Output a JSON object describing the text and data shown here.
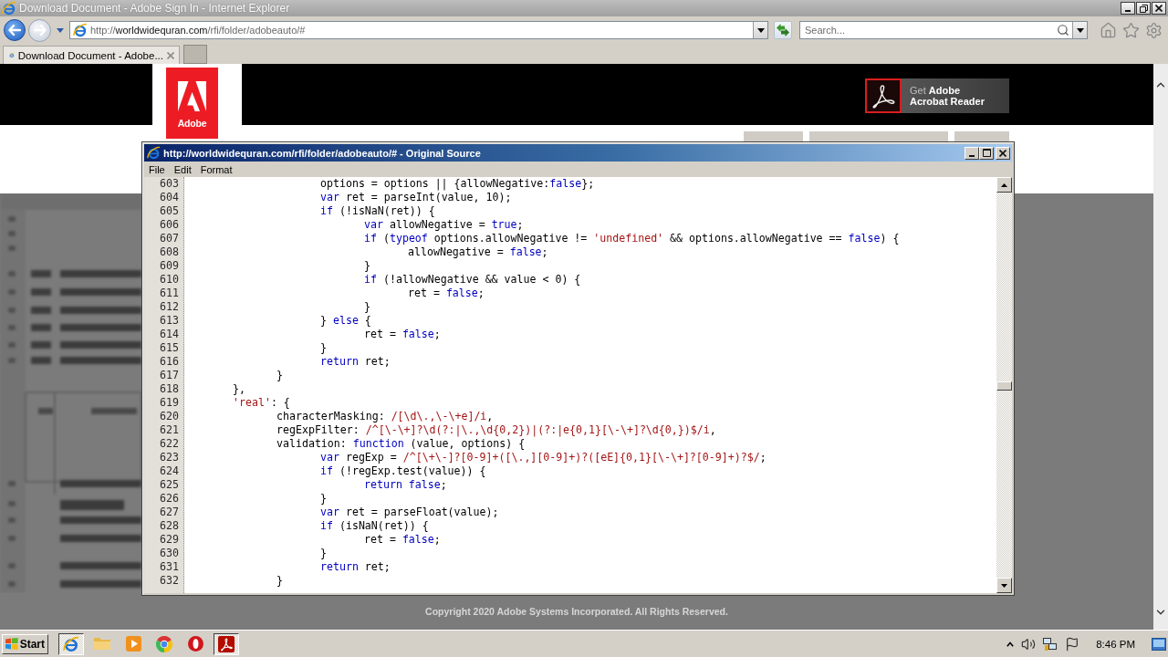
{
  "browser": {
    "title": "Download Document - Adobe Sign In - Internet Explorer",
    "address": {
      "scheme": "http://",
      "host": "worldwidequran.com",
      "path": "/rfi/folder/adobeauto/#"
    },
    "search": {
      "placeholder": "Search..."
    },
    "tabs": [
      {
        "label": "Download Document - Adobe...",
        "selected": true
      }
    ]
  },
  "page": {
    "logo_text": "Adobe",
    "reader_button": {
      "line_1": "Get **Adobe**",
      "line_2": "Acrobat Reader"
    },
    "copyright": "Copyright 2020 Adobe Systems Incorporated. All Rights Reserved."
  },
  "source_window": {
    "title": "http://worldwidequran.com/rfi/folder/adobeauto/# - Original Source",
    "menu": [
      "File",
      "Edit",
      "Format"
    ],
    "lines": [
      {
        "number": "603",
        "tokens": [
          {
            "kind": "plain",
            "text": "\t\t\toptions = options || {allowNegative:"
          },
          {
            "kind": "keyword",
            "text": "false"
          },
          {
            "kind": "plain",
            "text": "};"
          }
        ]
      },
      {
        "number": "604",
        "tokens": [
          {
            "kind": "keyword",
            "text": "\t\t\tvar"
          },
          {
            "kind": "plain",
            "text": " ret = parseInt(value, 10);"
          }
        ]
      },
      {
        "number": "605",
        "tokens": [
          {
            "kind": "keyword",
            "text": "\t\t\tif"
          },
          {
            "kind": "plain",
            "text": " (!isNaN(ret)) {"
          }
        ]
      },
      {
        "number": "606",
        "tokens": [
          {
            "kind": "keyword",
            "text": "\t\t\t\tvar"
          },
          {
            "kind": "plain",
            "text": " allowNegative = "
          },
          {
            "kind": "keyword",
            "text": "true"
          },
          {
            "kind": "plain",
            "text": ";"
          }
        ]
      },
      {
        "number": "607",
        "tokens": [
          {
            "kind": "keyword",
            "text": "\t\t\t\tif"
          },
          {
            "kind": "plain",
            "text": " ("
          },
          {
            "kind": "keyword",
            "text": "typeof"
          },
          {
            "kind": "plain",
            "text": " options.allowNegative != "
          },
          {
            "kind": "string",
            "text": "'undefined'"
          },
          {
            "kind": "plain",
            "text": " && options.allowNegative == "
          },
          {
            "kind": "keyword",
            "text": "false"
          },
          {
            "kind": "plain",
            "text": ") {"
          }
        ]
      },
      {
        "number": "608",
        "tokens": [
          {
            "kind": "plain",
            "text": "\t\t\t\t\tallowNegative = "
          },
          {
            "kind": "keyword",
            "text": "false"
          },
          {
            "kind": "plain",
            "text": ";"
          }
        ]
      },
      {
        "number": "609",
        "tokens": [
          {
            "kind": "plain",
            "text": "\t\t\t\t}"
          }
        ]
      },
      {
        "number": "610",
        "tokens": [
          {
            "kind": "keyword",
            "text": "\t\t\t\tif"
          },
          {
            "kind": "plain",
            "text": " (!allowNegative && value < 0) {"
          }
        ]
      },
      {
        "number": "611",
        "tokens": [
          {
            "kind": "plain",
            "text": "\t\t\t\t\tret = "
          },
          {
            "kind": "keyword",
            "text": "false"
          },
          {
            "kind": "plain",
            "text": ";"
          }
        ]
      },
      {
        "number": "612",
        "tokens": [
          {
            "kind": "plain",
            "text": "\t\t\t\t}"
          }
        ]
      },
      {
        "number": "613",
        "tokens": [
          {
            "kind": "plain",
            "text": "\t\t\t} "
          },
          {
            "kind": "keyword",
            "text": "else"
          },
          {
            "kind": "plain",
            "text": " {"
          }
        ]
      },
      {
        "number": "614",
        "tokens": [
          {
            "kind": "plain",
            "text": "\t\t\t\tret = "
          },
          {
            "kind": "keyword",
            "text": "false"
          },
          {
            "kind": "plain",
            "text": ";"
          }
        ]
      },
      {
        "number": "615",
        "tokens": [
          {
            "kind": "plain",
            "text": "\t\t\t}"
          }
        ]
      },
      {
        "number": "616",
        "tokens": [
          {
            "kind": "keyword",
            "text": "\t\t\treturn"
          },
          {
            "kind": "plain",
            "text": " ret;"
          }
        ]
      },
      {
        "number": "617",
        "tokens": [
          {
            "kind": "plain",
            "text": "\t\t}"
          }
        ]
      },
      {
        "number": "618",
        "tokens": [
          {
            "kind": "plain",
            "text": "\t},"
          }
        ]
      },
      {
        "number": "619",
        "tokens": [
          {
            "kind": "string",
            "text": "\t'real'"
          },
          {
            "kind": "plain",
            "text": ": {"
          }
        ]
      },
      {
        "number": "620",
        "tokens": [
          {
            "kind": "plain",
            "text": "\t\tcharacterMasking: "
          },
          {
            "kind": "string",
            "text": "/[\\d\\.,\\-\\+e]/i"
          },
          {
            "kind": "plain",
            "text": ","
          }
        ]
      },
      {
        "number": "621",
        "tokens": [
          {
            "kind": "plain",
            "text": "\t\tregExpFilter: "
          },
          {
            "kind": "string",
            "text": "/^[\\-\\+]?\\d(?:|\\.,\\d{0,2})|(?:|e{0,1}[\\-\\+]?\\d{0,})$/i"
          },
          {
            "kind": "plain",
            "text": ","
          }
        ]
      },
      {
        "number": "622",
        "tokens": [
          {
            "kind": "plain",
            "text": "\t\tvalidation: "
          },
          {
            "kind": "keyword",
            "text": "function"
          },
          {
            "kind": "plain",
            "text": " (value, options) {"
          }
        ]
      },
      {
        "number": "623",
        "tokens": [
          {
            "kind": "keyword",
            "text": "\t\t\tvar"
          },
          {
            "kind": "plain",
            "text": " regExp = "
          },
          {
            "kind": "string",
            "text": "/^[\\+\\-]?[0-9]+([\\.,][0-9]+)?([eE]{0,1}[\\-\\+]?[0-9]+)?$/"
          },
          {
            "kind": "plain",
            "text": ";"
          }
        ]
      },
      {
        "number": "624",
        "tokens": [
          {
            "kind": "keyword",
            "text": "\t\t\tif"
          },
          {
            "kind": "plain",
            "text": " (!regExp.test(value)) {"
          }
        ]
      },
      {
        "number": "625",
        "tokens": [
          {
            "kind": "keyword",
            "text": "\t\t\t\treturn false"
          },
          {
            "kind": "plain",
            "text": ";"
          }
        ]
      },
      {
        "number": "626",
        "tokens": [
          {
            "kind": "plain",
            "text": "\t\t\t}"
          }
        ]
      },
      {
        "number": "627",
        "tokens": [
          {
            "kind": "keyword",
            "text": "\t\t\tvar"
          },
          {
            "kind": "plain",
            "text": " ret = parseFloat(value);"
          }
        ]
      },
      {
        "number": "628",
        "tokens": [
          {
            "kind": "keyword",
            "text": "\t\t\tif"
          },
          {
            "kind": "plain",
            "text": " (isNaN(ret)) {"
          }
        ]
      },
      {
        "number": "629",
        "tokens": [
          {
            "kind": "plain",
            "text": "\t\t\t\tret = "
          },
          {
            "kind": "keyword",
            "text": "false"
          },
          {
            "kind": "plain",
            "text": ";"
          }
        ]
      },
      {
        "number": "630",
        "tokens": [
          {
            "kind": "plain",
            "text": "\t\t\t}"
          }
        ]
      },
      {
        "number": "631",
        "tokens": [
          {
            "kind": "keyword",
            "text": "\t\t\treturn"
          },
          {
            "kind": "plain",
            "text": " ret;"
          }
        ]
      },
      {
        "number": "632",
        "tokens": [
          {
            "kind": "plain",
            "text": "\t\t}"
          }
        ]
      }
    ]
  },
  "taskbar": {
    "start": "Start",
    "apps": [
      {
        "kind": "browser",
        "active": true
      },
      {
        "kind": "folder",
        "active": false
      },
      {
        "kind": "player",
        "active": false
      },
      {
        "kind": "wheel",
        "active": false
      },
      {
        "kind": "ring",
        "active": false
      },
      {
        "kind": "pdf",
        "active": true
      }
    ],
    "clock": "8:46 PM"
  }
}
